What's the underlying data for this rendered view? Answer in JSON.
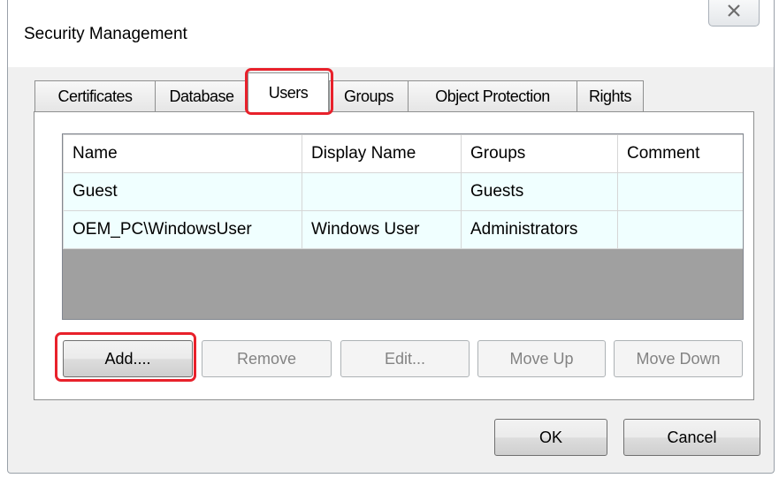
{
  "window": {
    "title": "Security Management",
    "close_icon": "close-icon"
  },
  "tabs": [
    {
      "label": "Certificates",
      "active": false
    },
    {
      "label": "Database",
      "active": false
    },
    {
      "label": "Users",
      "active": true
    },
    {
      "label": "Groups",
      "active": false
    },
    {
      "label": "Object Protection",
      "active": false
    },
    {
      "label": "Rights",
      "active": false
    }
  ],
  "users_table": {
    "columns": [
      "Name",
      "Display Name",
      "Groups",
      "Comment"
    ],
    "rows": [
      {
        "name": "Guest",
        "display_name": "",
        "groups": "Guests",
        "comment": ""
      },
      {
        "name": "OEM_PC\\WindowsUser",
        "display_name": "Windows User",
        "groups": "Administrators",
        "comment": ""
      }
    ]
  },
  "actions": {
    "add": "Add....",
    "remove": "Remove",
    "edit": "Edit...",
    "move_up": "Move Up",
    "move_down": "Move Down"
  },
  "footer": {
    "ok": "OK",
    "cancel": "Cancel"
  },
  "colors": {
    "highlight": "#e8212b",
    "row_background": "#f0ffff",
    "empty_grid": "#a0a0a0"
  }
}
